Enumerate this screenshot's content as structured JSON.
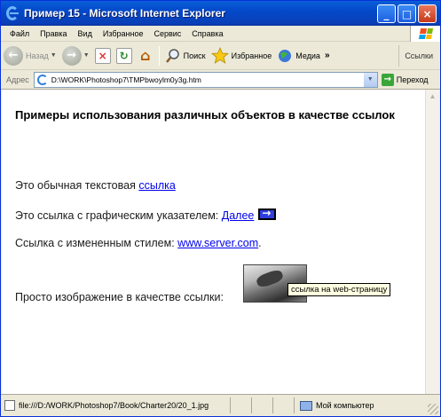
{
  "window": {
    "title": "Пример 15 - Microsoft Internet Explorer",
    "minimize": "_",
    "maximize": "□",
    "close": "×"
  },
  "menu": [
    "Файл",
    "Правка",
    "Вид",
    "Избранное",
    "Сервис",
    "Справка"
  ],
  "toolbar": {
    "back": "Назад",
    "back_glyph": "←",
    "forward_glyph": "→",
    "stop_glyph": "×",
    "refresh_glyph": "↻",
    "home_glyph": "⌂",
    "search": "Поиск",
    "favorites": "Избранное",
    "media": "Медиа",
    "more": "»",
    "links": "Ссылки"
  },
  "address": {
    "label": "Адрес",
    "value": "D:\\WORK\\Photoshop7\\TMPbwoylm0y3g.htm",
    "go": "Переход"
  },
  "page": {
    "heading": "Примеры использования различных объектов в качестве ссылок",
    "line1_text": "Это обычная текстовая ",
    "line1_link": "ссылка",
    "line2_text": "Это ссылка с графическим указателем: ",
    "line2_link": "Далее",
    "line3_text": "Ссылка с измененным стилем: ",
    "line3_link": "www.server.com",
    "line3_after": ".",
    "line4_text": "Просто изображение в качестве ссылки: ",
    "tooltip": "ссылка на web-страницу"
  },
  "status": {
    "url": "file:///D:/WORK/Photoshop7/Book/Charter20/20_1.jpg",
    "zone": "Мой компьютер"
  },
  "colors": {
    "titlebar": "#0a5fd8",
    "link": "#0000ee",
    "tooltip_bg": "#ffffe1",
    "chrome": "#ece9d8"
  },
  "icons": {
    "title": "ie-logo-icon",
    "search": "magnifier-icon",
    "favorites": "star-icon",
    "media": "media-globe-icon",
    "status": "file-icon",
    "zone": "my-computer-icon"
  }
}
